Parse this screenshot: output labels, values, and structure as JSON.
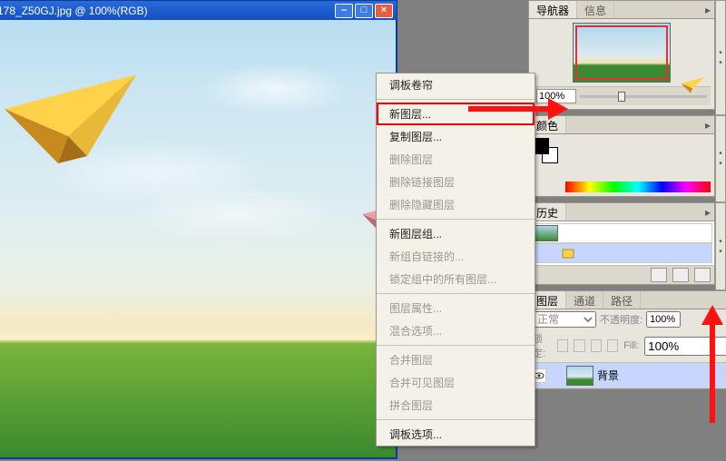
{
  "doc": {
    "title": "178_Z50GJ.jpg @ 100%(RGB)"
  },
  "navigator": {
    "tab1": "导航器",
    "tab2": "信息",
    "zoom": "100%"
  },
  "color": {
    "tab": "颜色"
  },
  "history": {
    "tab": "历史"
  },
  "layers": {
    "tab1": "图层",
    "tab2": "通道",
    "tab3": "路径",
    "blend": "正常",
    "opacity_label": "不透明度:",
    "opacity": "100%",
    "lock_label": "锁定:",
    "fill_label": "Fill:",
    "fill": "100%",
    "layer0": "背景"
  },
  "flyout": {
    "i0": "调板卷帘",
    "i1": "新图层...",
    "i2": "复制图层...",
    "i3": "删除图层",
    "i4": "删除链接图层",
    "i5": "删除隐藏图层",
    "i6": "新图层组...",
    "i7": "新组自链接的...",
    "i8": "锁定组中的所有图层...",
    "i9": "图层属性...",
    "i10": "混合选项...",
    "i11": "合并图层",
    "i12": "合并可见图层",
    "i13": "拼合图层",
    "i14": "调板选项..."
  }
}
